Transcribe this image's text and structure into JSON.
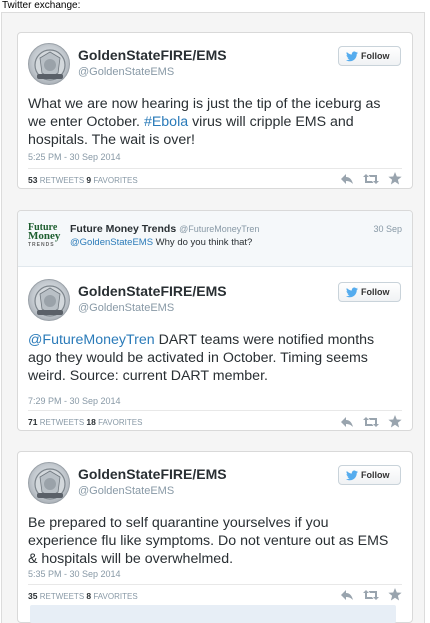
{
  "page_heading": "Twitter exchange:",
  "colors": {
    "link": "#2b7bb9",
    "muted": "#8899a6",
    "text": "#292f33",
    "twitter_blue": "#55acee"
  },
  "tweets": [
    {
      "name": "GoldenStateFIRE/EMS",
      "handle": "@GoldenStateEMS",
      "follow_label": "Follow",
      "text_before": "What we are now hearing is just the tip of the iceburg as we enter October. ",
      "text_link": "#Ebola",
      "text_after": " virus will cripple EMS and hospitals. The wait is over!",
      "timestamp": "5:25 PM - 30 Sep 2014",
      "retweets": "53",
      "retweets_label": "RETWEETS",
      "favorites": "9",
      "favorites_label": "FAVORITES"
    },
    {
      "reply_in": {
        "logo_line1": "Future",
        "logo_line2": "Money",
        "logo_line3": "TRENDS",
        "name": "Future Money Trends",
        "handle": "@FutureMoneyTren",
        "date": "30 Sep",
        "mention": "@GoldenStateEMS",
        "text": " Why do you think that?"
      },
      "name": "GoldenStateFIRE/EMS",
      "handle": "@GoldenStateEMS",
      "follow_label": "Follow",
      "text_link": "@FutureMoneyTren",
      "text_after": " DART teams were notified months ago they would be activated in October. Timing seems weird. Source: current DART member.",
      "timestamp": "7:29 PM - 30 Sep 2014",
      "retweets": "71",
      "retweets_label": "RETWEETS",
      "favorites": "18",
      "favorites_label": "FAVORITES"
    },
    {
      "name": "GoldenStateFIRE/EMS",
      "handle": "@GoldenStateEMS",
      "follow_label": "Follow",
      "text": "Be prepared to self quarantine yourselves if you experience flu like symptoms. Do not venture out as EMS & hospitals will be overwhelmed.",
      "timestamp": "5:35 PM - 30 Sep 2014",
      "retweets": "35",
      "retweets_label": "RETWEETS",
      "favorites": "8",
      "favorites_label": "FAVORITES"
    }
  ]
}
